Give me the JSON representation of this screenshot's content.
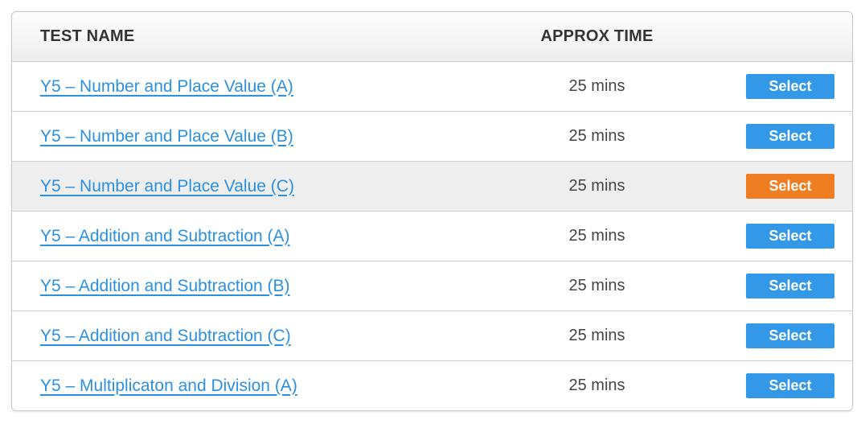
{
  "table": {
    "columns": {
      "name": "TEST NAME",
      "time": "APPROX TIME",
      "action": ""
    },
    "rows": [
      {
        "name": "Y5 – Number and Place Value (A)",
        "time": "25 mins",
        "button_label": "Select",
        "button_state": "default",
        "row_state": "default"
      },
      {
        "name": "Y5 – Number and Place Value (B)",
        "time": "25 mins",
        "button_label": "Select",
        "button_state": "default",
        "row_state": "default"
      },
      {
        "name": "Y5 – Number and Place Value (C)",
        "time": "25 mins",
        "button_label": "Select",
        "button_state": "highlighted",
        "row_state": "highlighted"
      },
      {
        "name": "Y5 – Addition and Subtraction (A)",
        "time": "25 mins",
        "button_label": "Select",
        "button_state": "default",
        "row_state": "default"
      },
      {
        "name": "Y5 – Addition and Subtraction (B)",
        "time": "25 mins",
        "button_label": "Select",
        "button_state": "default",
        "row_state": "default"
      },
      {
        "name": "Y5 – Addition and Subtraction (C)",
        "time": "25 mins",
        "button_label": "Select",
        "button_state": "default",
        "row_state": "default"
      },
      {
        "name": "Y5 – Multiplicaton and Division (A)",
        "time": "25 mins",
        "button_label": "Select",
        "button_state": "default",
        "row_state": "default"
      }
    ]
  },
  "colors": {
    "link": "#2b90e0",
    "button_default": "#3498e8",
    "button_highlight": "#ef7e22",
    "row_highlight": "#eeeeee",
    "header_text": "#333333",
    "time_text": "#444444",
    "border": "#c9c9c9"
  }
}
